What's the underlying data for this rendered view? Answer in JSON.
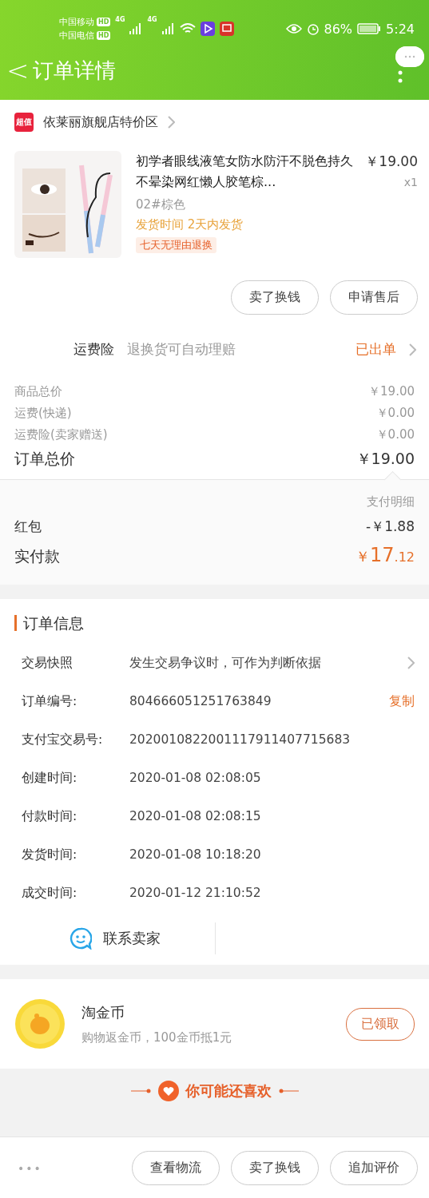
{
  "status_bar": {
    "carriers": [
      {
        "name": "中国移动",
        "badge": "HD"
      },
      {
        "name": "中国电信",
        "badge": "HD"
      }
    ],
    "networks": [
      "4G",
      "4G"
    ],
    "battery": "86%",
    "time": "5:24"
  },
  "header": {
    "back": "<",
    "title": "订单详情"
  },
  "store": {
    "badge": "超值",
    "name": "依莱丽旗舰店特价区"
  },
  "product": {
    "title": "初学者眼线液笔女防水防汗不脱色持久不晕染网红懒人胶笔棕...",
    "price": "￥19.00",
    "qty": "x1",
    "sku": "02#棕色",
    "shipping_label": "发货时间",
    "shipping_value": "2天内发货",
    "tag": "七天无理由退换"
  },
  "item_actions": [
    "卖了换钱",
    "申请售后"
  ],
  "insurance": {
    "label": "运费险",
    "desc": "退换货可自动理赔",
    "status": "已出单"
  },
  "price_rows": [
    {
      "label": "商品总价",
      "value": "￥19.00",
      "kind": "minor"
    },
    {
      "label": "运费(快递)",
      "value": "￥0.00",
      "kind": "minor"
    },
    {
      "label": "运费险(卖家赠送)",
      "value": "￥0.00",
      "kind": "minor"
    },
    {
      "label": "订单总价",
      "value": "￥19.00",
      "kind": "total"
    }
  ],
  "payment": {
    "title": "支付明细",
    "rows": [
      {
        "label": "红包",
        "value": "-￥1.88"
      }
    ],
    "paid_label": "实付款",
    "paid_currency": "￥",
    "paid_int": "17",
    "paid_dec": ".12"
  },
  "order_info": {
    "title": "订单信息",
    "rows": [
      {
        "label": "交易快照",
        "value": "发生交易争议时，可作为判断依据",
        "kind": "link"
      },
      {
        "label": "订单编号:",
        "value": "804666051251763849",
        "action": "复制",
        "kind": "copy"
      },
      {
        "label": "支付宝交易号:",
        "value": "2020010822001117911407715683",
        "kind": "plain"
      },
      {
        "label": "创建时间:",
        "value": "2020-01-08 02:08:05",
        "kind": "plain"
      },
      {
        "label": "付款时间:",
        "value": "2020-01-08 02:08:15",
        "kind": "plain"
      },
      {
        "label": "发货时间:",
        "value": "2020-01-08 10:18:20",
        "kind": "plain"
      },
      {
        "label": "成交时间:",
        "value": "2020-01-12 21:10:52",
        "kind": "plain"
      }
    ],
    "contact": "联系卖家"
  },
  "coins": {
    "title": "淘金币",
    "desc": "购物返金币，100金币抵1元",
    "button": "已领取"
  },
  "recommend": {
    "title": "你可能还喜欢"
  },
  "bottom_bar": {
    "more": "•••",
    "buttons": [
      "查看物流",
      "卖了换钱",
      "追加评价"
    ]
  }
}
